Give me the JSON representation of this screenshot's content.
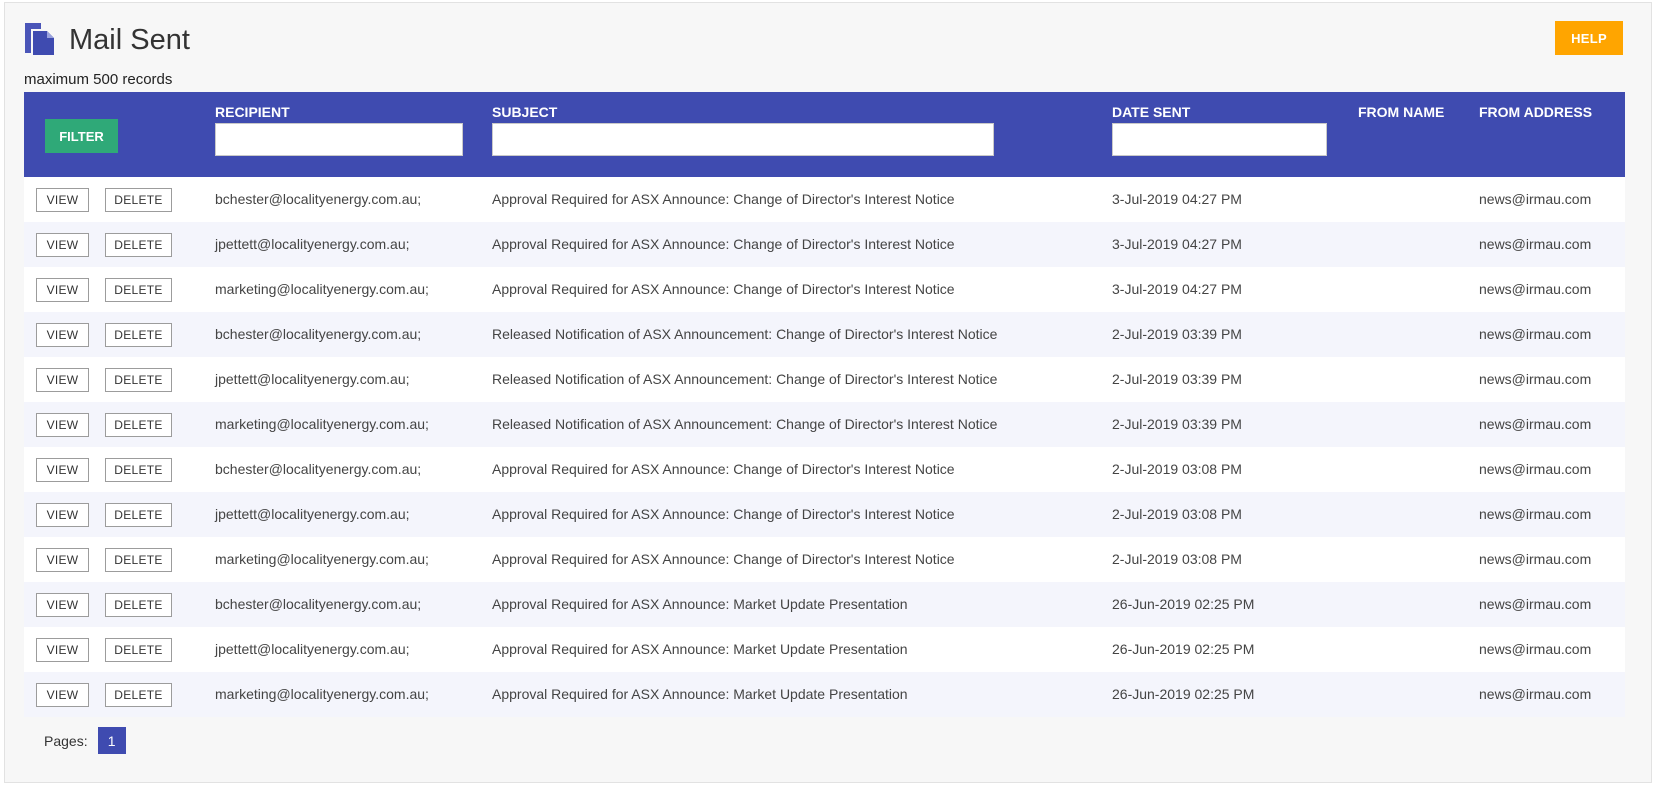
{
  "page": {
    "title": "Mail Sent",
    "icon": "documents-icon",
    "help_label": "HELP",
    "records_note": "maximum 500 records"
  },
  "colors": {
    "header_bg": "#3f4bb0",
    "filter_button": "#2fa978",
    "help_button": "#ffa500",
    "row_alt": "#f4f5fc"
  },
  "table": {
    "filter_label": "FILTER",
    "columns": {
      "recipient": "RECIPIENT",
      "subject": "SUBJECT",
      "date_sent": "DATE SENT",
      "from_name": "FROM NAME",
      "from_address": "FROM ADDRESS"
    },
    "filters": {
      "recipient": "",
      "subject": "",
      "date_sent": ""
    },
    "view_label": "VIEW",
    "delete_label": "DELETE",
    "rows": [
      {
        "recipient": "bchester@localityenergy.com.au;",
        "subject": "Approval Required for ASX Announce: Change of Director's Interest Notice",
        "date_sent": "3-Jul-2019 04:27 PM",
        "from_name": "",
        "from_address": "news@irmau.com"
      },
      {
        "recipient": "jpettett@localityenergy.com.au;",
        "subject": "Approval Required for ASX Announce: Change of Director's Interest Notice",
        "date_sent": "3-Jul-2019 04:27 PM",
        "from_name": "",
        "from_address": "news@irmau.com"
      },
      {
        "recipient": "marketing@localityenergy.com.au;",
        "subject": "Approval Required for ASX Announce: Change of Director's Interest Notice",
        "date_sent": "3-Jul-2019 04:27 PM",
        "from_name": "",
        "from_address": "news@irmau.com"
      },
      {
        "recipient": "bchester@localityenergy.com.au;",
        "subject": "Released Notification of ASX Announcement: Change of Director's Interest Notice",
        "date_sent": "2-Jul-2019 03:39 PM",
        "from_name": "",
        "from_address": "news@irmau.com"
      },
      {
        "recipient": "jpettett@localityenergy.com.au;",
        "subject": "Released Notification of ASX Announcement: Change of Director's Interest Notice",
        "date_sent": "2-Jul-2019 03:39 PM",
        "from_name": "",
        "from_address": "news@irmau.com"
      },
      {
        "recipient": "marketing@localityenergy.com.au;",
        "subject": "Released Notification of ASX Announcement: Change of Director's Interest Notice",
        "date_sent": "2-Jul-2019 03:39 PM",
        "from_name": "",
        "from_address": "news@irmau.com"
      },
      {
        "recipient": "bchester@localityenergy.com.au;",
        "subject": "Approval Required for ASX Announce: Change of Director's Interest Notice",
        "date_sent": "2-Jul-2019 03:08 PM",
        "from_name": "",
        "from_address": "news@irmau.com"
      },
      {
        "recipient": "jpettett@localityenergy.com.au;",
        "subject": "Approval Required for ASX Announce: Change of Director's Interest Notice",
        "date_sent": "2-Jul-2019 03:08 PM",
        "from_name": "",
        "from_address": "news@irmau.com"
      },
      {
        "recipient": "marketing@localityenergy.com.au;",
        "subject": "Approval Required for ASX Announce: Change of Director's Interest Notice",
        "date_sent": "2-Jul-2019 03:08 PM",
        "from_name": "",
        "from_address": "news@irmau.com"
      },
      {
        "recipient": "bchester@localityenergy.com.au;",
        "subject": "Approval Required for ASX Announce: Market Update Presentation",
        "date_sent": "26-Jun-2019 02:25 PM",
        "from_name": "",
        "from_address": "news@irmau.com"
      },
      {
        "recipient": "jpettett@localityenergy.com.au;",
        "subject": "Approval Required for ASX Announce: Market Update Presentation",
        "date_sent": "26-Jun-2019 02:25 PM",
        "from_name": "",
        "from_address": "news@irmau.com"
      },
      {
        "recipient": "marketing@localityenergy.com.au;",
        "subject": "Approval Required for ASX Announce: Market Update Presentation",
        "date_sent": "26-Jun-2019 02:25 PM",
        "from_name": "",
        "from_address": "news@irmau.com"
      }
    ]
  },
  "pagination": {
    "label": "Pages:",
    "pages": [
      "1"
    ],
    "current": "1"
  }
}
